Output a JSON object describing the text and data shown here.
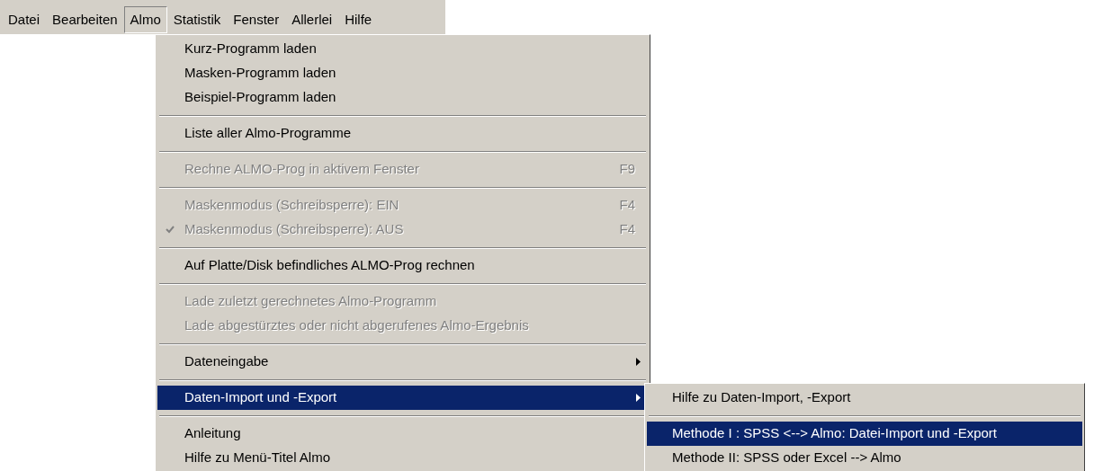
{
  "menu_bar": [
    {
      "label": "Datei",
      "selected": false
    },
    {
      "label": "Bearbeiten",
      "selected": false
    },
    {
      "label": "Almo",
      "selected": true
    },
    {
      "label": "Statistik",
      "selected": false
    },
    {
      "label": "Fenster",
      "selected": false
    },
    {
      "label": "Allerlei",
      "selected": false
    },
    {
      "label": "Hilfe",
      "selected": false
    }
  ],
  "menu": {
    "items": [
      {
        "kind": "item",
        "label": "Kurz-Programm laden",
        "disabled": false,
        "checked": false,
        "selected": false,
        "has_submenu": false
      },
      {
        "kind": "item",
        "label": "Masken-Programm laden",
        "disabled": false,
        "checked": false,
        "selected": false,
        "has_submenu": false
      },
      {
        "kind": "item",
        "label": "Beispiel-Programm laden",
        "disabled": false,
        "checked": false,
        "selected": false,
        "has_submenu": false
      },
      {
        "kind": "separator"
      },
      {
        "kind": "item",
        "label": "Liste aller Almo-Programme",
        "disabled": false,
        "checked": false,
        "selected": false,
        "has_submenu": false
      },
      {
        "kind": "separator"
      },
      {
        "kind": "item",
        "label": "Rechne ALMO-Prog in aktivem Fenster",
        "shortcut": "F9",
        "disabled": true,
        "checked": false,
        "selected": false,
        "has_submenu": false
      },
      {
        "kind": "separator"
      },
      {
        "kind": "item",
        "label": "Maskenmodus (Schreibsperre): EIN",
        "shortcut": "F4",
        "disabled": true,
        "checked": false,
        "selected": false,
        "has_submenu": false
      },
      {
        "kind": "item",
        "label": "Maskenmodus (Schreibsperre): AUS",
        "shortcut": "F4",
        "disabled": true,
        "checked": true,
        "selected": false,
        "has_submenu": false
      },
      {
        "kind": "separator"
      },
      {
        "kind": "item",
        "label": "Auf Platte/Disk befindliches ALMO-Prog rechnen",
        "disabled": false,
        "checked": false,
        "selected": false,
        "has_submenu": false
      },
      {
        "kind": "separator"
      },
      {
        "kind": "item",
        "label": "Lade zuletzt gerechnetes Almo-Programm",
        "disabled": true,
        "checked": false,
        "selected": false,
        "has_submenu": false
      },
      {
        "kind": "item",
        "label": "Lade abgestürztes oder nicht abgerufenes Almo-Ergebnis",
        "disabled": true,
        "checked": false,
        "selected": false,
        "has_submenu": false
      },
      {
        "kind": "separator"
      },
      {
        "kind": "item",
        "label": "Dateneingabe",
        "disabled": false,
        "checked": false,
        "selected": false,
        "has_submenu": true
      },
      {
        "kind": "separator"
      },
      {
        "kind": "item",
        "label": "Daten-Import und -Export",
        "disabled": false,
        "checked": false,
        "selected": true,
        "has_submenu": true
      },
      {
        "kind": "separator"
      },
      {
        "kind": "item",
        "label": "Anleitung",
        "disabled": false,
        "checked": false,
        "selected": false,
        "has_submenu": false
      },
      {
        "kind": "item",
        "label": "Hilfe zu Menü-Titel Almo",
        "disabled": false,
        "checked": false,
        "selected": false,
        "has_submenu": false
      }
    ]
  },
  "submenu": {
    "items": [
      {
        "kind": "item",
        "label": "Hilfe zu Daten-Import, -Export",
        "disabled": false,
        "selected": false
      },
      {
        "kind": "separator"
      },
      {
        "kind": "item",
        "label": "Methode I : SPSS <--> Almo: Datei-Import und -Export",
        "disabled": false,
        "selected": true
      },
      {
        "kind": "item",
        "label": "Methode II: SPSS oder Excel --> Almo",
        "disabled": false,
        "selected": false
      }
    ]
  }
}
